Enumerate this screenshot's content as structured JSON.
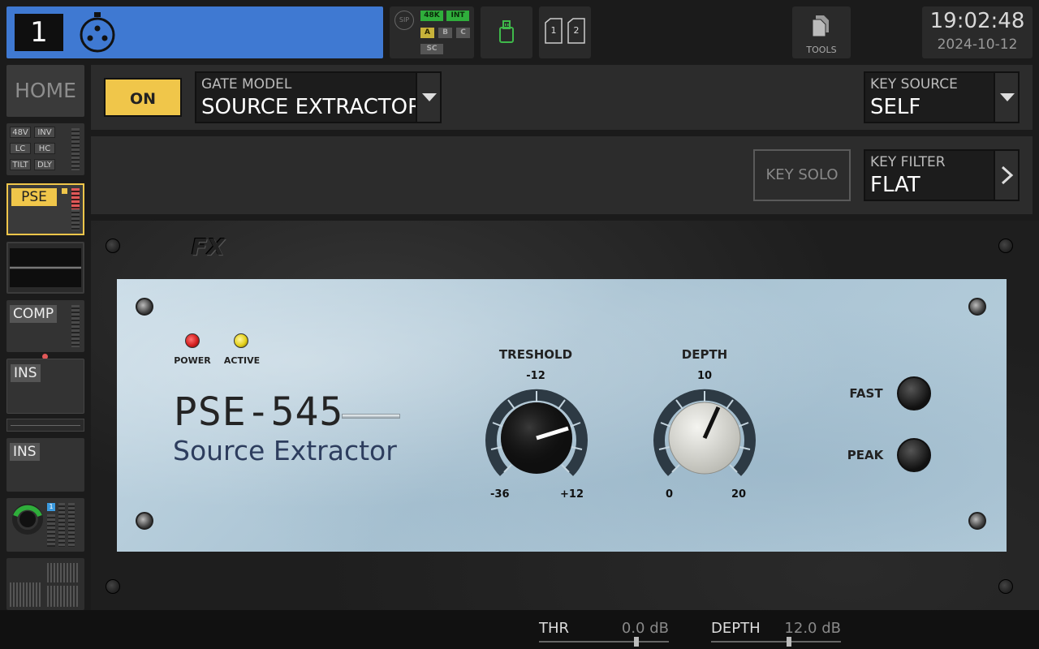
{
  "channel": {
    "number": "1",
    "icon": "xlr-input-icon",
    "color": "#3f79d2"
  },
  "status": {
    "sip": "SIP",
    "rate": "48K",
    "clock": "INT",
    "a": "A",
    "b": "B",
    "c": "C",
    "sc": "SC"
  },
  "usb": {
    "icon": "usb-drive-icon"
  },
  "sd": {
    "slot1": "1",
    "slot2": "2"
  },
  "tools": {
    "label": "TOOLS",
    "icon": "tools-icon"
  },
  "clock": {
    "time": "19:02:48",
    "date": "2024-10-12"
  },
  "sidebar": {
    "home": "HOME",
    "preamp": {
      "b48v": "48V",
      "inv": "INV",
      "lc": "LC",
      "hc": "HC",
      "tilt": "TILT",
      "dly": "DLY"
    },
    "pse": "PSE",
    "comp": "COMP",
    "ins1": "INS",
    "ins2": "INS",
    "pan_badge": "1"
  },
  "controls": {
    "on_label": "ON",
    "gate_model": {
      "label": "GATE MODEL",
      "value": "SOURCE EXTRACTOR"
    },
    "key_source": {
      "label": "KEY SOURCE",
      "value": "SELF"
    },
    "key_solo": "KEY SOLO",
    "key_filter": {
      "label": "KEY FILTER",
      "value": "FLAT"
    }
  },
  "plugin": {
    "fx_logo": "FX",
    "power": "POWER",
    "active": "ACTIVE",
    "model": "PSE-545",
    "subtitle": "Source Extractor",
    "threshold": {
      "label": "TRESHOLD",
      "top": "-12",
      "min": "-36",
      "max": "+12"
    },
    "depth": {
      "label": "DEPTH",
      "top": "10",
      "min": "0",
      "max": "20"
    },
    "fast": "FAST",
    "peak": "PEAK",
    "colors": {
      "power_led": "#d42020",
      "active_led": "#e4d01a"
    }
  },
  "bottom": {
    "thr": {
      "label": "THR",
      "value": "0.0 dB",
      "level": 0.75
    },
    "depth": {
      "label": "DEPTH",
      "value": "12.0 dB",
      "level": 0.6
    }
  }
}
